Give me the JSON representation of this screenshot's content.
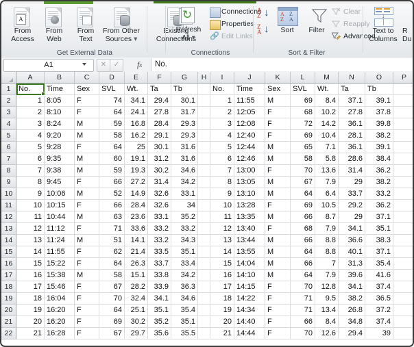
{
  "ribbon": {
    "groups": [
      {
        "name": "Get External Data",
        "label": "Get External Data"
      },
      {
        "name": "Connections",
        "label": "Connections"
      },
      {
        "name": "Sort & Filter",
        "label": "Sort & Filter"
      }
    ],
    "get_external_data": {
      "from_access": "From\nAccess",
      "from_access_l1": "From",
      "from_access_l2": "Access",
      "from_web_l1": "From",
      "from_web_l2": "Web",
      "from_text_l1": "From",
      "from_text_l2": "Text",
      "from_other_l1": "From Other",
      "from_other_l2": "Sources",
      "existing_l1": "Existing",
      "existing_l2": "Connections"
    },
    "connections": {
      "refresh_l1": "Refresh",
      "refresh_l2": "All",
      "connections": "Connections",
      "properties": "Properties",
      "edit_links": "Edit Links"
    },
    "sort_filter": {
      "sort": "Sort",
      "filter": "Filter",
      "clear": "Clear",
      "reapply": "Reapply",
      "advanced": "Advanced"
    },
    "data_tools": {
      "text_to_columns_l1": "Text to",
      "text_to_columns_l2": "Columns",
      "remove_dup_l1": "R",
      "remove_dup_l2": "Du"
    }
  },
  "formula_bar": {
    "name_box": "A1",
    "cancel": "✕",
    "enter": "✓",
    "fx": "f",
    "fx_sub": "x",
    "content": "No."
  },
  "grid": {
    "selected_cell": "A1",
    "columns": [
      "A",
      "B",
      "C",
      "D",
      "E",
      "F",
      "G",
      "H",
      "I",
      "J",
      "K",
      "L",
      "M",
      "N",
      "O",
      "P"
    ],
    "row_numbers": [
      1,
      2,
      3,
      4,
      5,
      6,
      7,
      8,
      9,
      10,
      11,
      12,
      13,
      14,
      15,
      16,
      17,
      18,
      19,
      20,
      21,
      22
    ],
    "headers_left": [
      "No.",
      "Time",
      "Sex",
      "SVL",
      "Wt.",
      "Ta",
      "Tb"
    ],
    "headers_right": [
      "No.",
      "Time",
      "Sex",
      "SVL",
      "Wt.",
      "Ta",
      "Tb"
    ],
    "rows": [
      {
        "r": 1,
        "left": [
          "No.",
          "Time",
          "Sex",
          "SVL",
          "Wt.",
          "Ta",
          "Tb"
        ],
        "gap": "",
        "right": [
          "No.",
          "Time",
          "Sex",
          "SVL",
          "Wt.",
          "Ta",
          "Tb"
        ],
        "header": true
      },
      {
        "r": 2,
        "left": [
          "1",
          "8:05",
          "F",
          "74",
          "34.1",
          "29.4",
          "30.1"
        ],
        "gap": "",
        "right": [
          "1",
          "11:55",
          "M",
          "69",
          "8.4",
          "37.1",
          "39.1"
        ]
      },
      {
        "r": 3,
        "left": [
          "2",
          "8:10",
          "F",
          "64",
          "24.1",
          "27.8",
          "31.7"
        ],
        "gap": "",
        "right": [
          "2",
          "12:05",
          "F",
          "68",
          "10.2",
          "27.8",
          "37.8"
        ]
      },
      {
        "r": 4,
        "left": [
          "3",
          "8:24",
          "M",
          "59",
          "16.8",
          "28.4",
          "29.3"
        ],
        "gap": "",
        "right": [
          "3",
          "12:08",
          "F",
          "72",
          "14.2",
          "36.1",
          "39.8"
        ]
      },
      {
        "r": 5,
        "left": [
          "4",
          "9:20",
          "M",
          "58",
          "16.2",
          "29.1",
          "29.3"
        ],
        "gap": "",
        "right": [
          "4",
          "12:40",
          "F",
          "69",
          "10.4",
          "28.1",
          "38.2"
        ]
      },
      {
        "r": 6,
        "left": [
          "5",
          "9:28",
          "F",
          "64",
          "25",
          "30.1",
          "31.6"
        ],
        "gap": "",
        "right": [
          "5",
          "12:44",
          "M",
          "65",
          "7.1",
          "36.1",
          "39.1"
        ]
      },
      {
        "r": 7,
        "left": [
          "6",
          "9:35",
          "M",
          "60",
          "19.1",
          "31.2",
          "31.6"
        ],
        "gap": "",
        "right": [
          "6",
          "12:46",
          "M",
          "58",
          "5.8",
          "28.6",
          "38.4"
        ]
      },
      {
        "r": 8,
        "left": [
          "7",
          "9:38",
          "M",
          "59",
          "19.3",
          "30.2",
          "34.6"
        ],
        "gap": "",
        "right": [
          "7",
          "13:00",
          "F",
          "70",
          "13.6",
          "31.4",
          "36.2"
        ]
      },
      {
        "r": 9,
        "left": [
          "8",
          "9:45",
          "F",
          "66",
          "27.2",
          "31.4",
          "34.2"
        ],
        "gap": "",
        "right": [
          "8",
          "13:05",
          "M",
          "67",
          "7.9",
          "29",
          "38.2"
        ]
      },
      {
        "r": 10,
        "left": [
          "9",
          "10:06",
          "M",
          "52",
          "14.9",
          "32.6",
          "33.1"
        ],
        "gap": "",
        "right": [
          "9",
          "13:10",
          "M",
          "64",
          "6.4",
          "33.7",
          "33.2"
        ]
      },
      {
        "r": 11,
        "left": [
          "10",
          "10:15",
          "F",
          "66",
          "28.4",
          "32.6",
          "34"
        ],
        "gap": "",
        "right": [
          "10",
          "13:28",
          "F",
          "69",
          "10.5",
          "29.2",
          "36.2"
        ]
      },
      {
        "r": 12,
        "left": [
          "11",
          "10:44",
          "M",
          "63",
          "23.6",
          "33.1",
          "35.2"
        ],
        "gap": "",
        "right": [
          "11",
          "13:35",
          "M",
          "66",
          "8.7",
          "29",
          "37.1"
        ]
      },
      {
        "r": 13,
        "left": [
          "12",
          "11:12",
          "F",
          "71",
          "33.6",
          "33.2",
          "33.2"
        ],
        "gap": "",
        "right": [
          "12",
          "13:40",
          "F",
          "68",
          "7.9",
          "34.1",
          "35.1"
        ]
      },
      {
        "r": 14,
        "left": [
          "13",
          "11:24",
          "M",
          "51",
          "14.1",
          "33.2",
          "34.3"
        ],
        "gap": "",
        "right": [
          "13",
          "13:44",
          "M",
          "66",
          "8.8",
          "36.6",
          "38.3"
        ]
      },
      {
        "r": 15,
        "left": [
          "14",
          "11:55",
          "F",
          "62",
          "21.4",
          "33.5",
          "35.1"
        ],
        "gap": "",
        "right": [
          "14",
          "13:55",
          "M",
          "64",
          "8.8",
          "40.1",
          "37.1"
        ]
      },
      {
        "r": 16,
        "left": [
          "15",
          "15:22",
          "F",
          "64",
          "26.3",
          "33.7",
          "33.4"
        ],
        "gap": "",
        "right": [
          "15",
          "14:04",
          "M",
          "66",
          "7",
          "31.3",
          "35.4"
        ]
      },
      {
        "r": 17,
        "left": [
          "16",
          "15:38",
          "M",
          "58",
          "15.1",
          "33.8",
          "34.2"
        ],
        "gap": "",
        "right": [
          "16",
          "14:10",
          "M",
          "64",
          "7.9",
          "39.6",
          "41.6"
        ]
      },
      {
        "r": 18,
        "left": [
          "17",
          "15:46",
          "F",
          "67",
          "28.2",
          "33.9",
          "36.3"
        ],
        "gap": "",
        "right": [
          "17",
          "14:15",
          "F",
          "70",
          "12.8",
          "34.1",
          "37.4"
        ]
      },
      {
        "r": 19,
        "left": [
          "18",
          "16:04",
          "F",
          "70",
          "32.4",
          "34.1",
          "34.6"
        ],
        "gap": "",
        "right": [
          "18",
          "14:22",
          "F",
          "71",
          "9.5",
          "38.2",
          "36.5"
        ]
      },
      {
        "r": 20,
        "left": [
          "19",
          "16:20",
          "F",
          "64",
          "25.1",
          "35.1",
          "35.4"
        ],
        "gap": "",
        "right": [
          "19",
          "14:34",
          "F",
          "71",
          "13.4",
          "26.8",
          "37.2"
        ]
      },
      {
        "r": 21,
        "left": [
          "20",
          "16:20",
          "F",
          "69",
          "30.2",
          "35.2",
          "35.1"
        ],
        "gap": "",
        "right": [
          "20",
          "14:40",
          "F",
          "66",
          "8.4",
          "34.8",
          "37.4"
        ]
      },
      {
        "r": 22,
        "left": [
          "21",
          "16:28",
          "F",
          "67",
          "29.7",
          "35.6",
          "35.5"
        ],
        "gap": "",
        "right": [
          "21",
          "14:44",
          "F",
          "70",
          "12.6",
          "29.4",
          "39"
        ]
      }
    ]
  },
  "colors": {
    "accent_green": "#5b9b2f",
    "selection": "#3c7c1f",
    "header_bg": "#e2e5e8",
    "grid_line": "#d8dce0"
  }
}
